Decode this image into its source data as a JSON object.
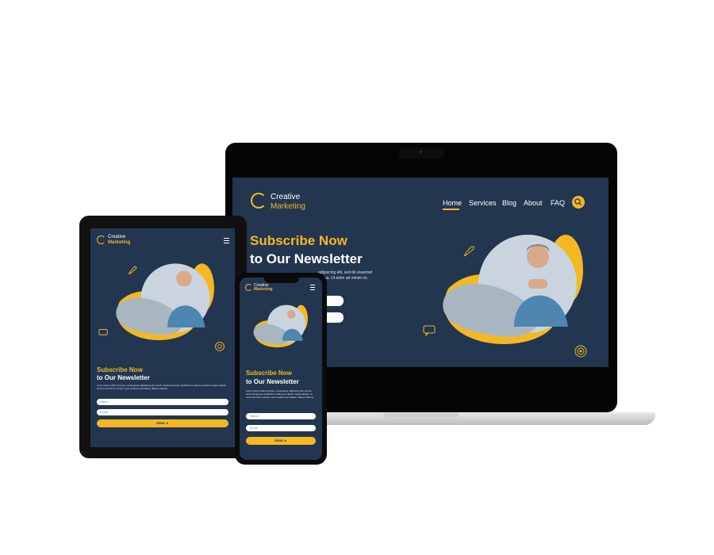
{
  "brand": {
    "line1": "Creative",
    "line2": "Marketing"
  },
  "nav": {
    "items": [
      "Home",
      "Services",
      "Blog",
      "About",
      "FAQ"
    ],
    "active": "Home"
  },
  "hero": {
    "title_line1": "Subscribe Now",
    "title_line2": "to Our Newsletter",
    "laptop_body_visible": "adipiscing elit, sed do eiusmod aliqua. Ut enim ad minim ris.",
    "body": "Lorem ipsum dolor sit amet, consectetur adipiscing elit, sed do eiusmod tempor incididunt ut labore et dolore magna aliqua. Ut enim ad minim veniam, quis nostrud exercitation ullamco laboris."
  },
  "form": {
    "name_placeholder": "Name",
    "email_placeholder": "Email",
    "send_label": "SEND ►"
  },
  "icons": [
    "rocket-icon",
    "chat-icon",
    "target-icon",
    "search-icon",
    "menu-icon"
  ],
  "colors": {
    "navy": "#233650",
    "accent": "#f5b822",
    "white": "#ffffff"
  }
}
